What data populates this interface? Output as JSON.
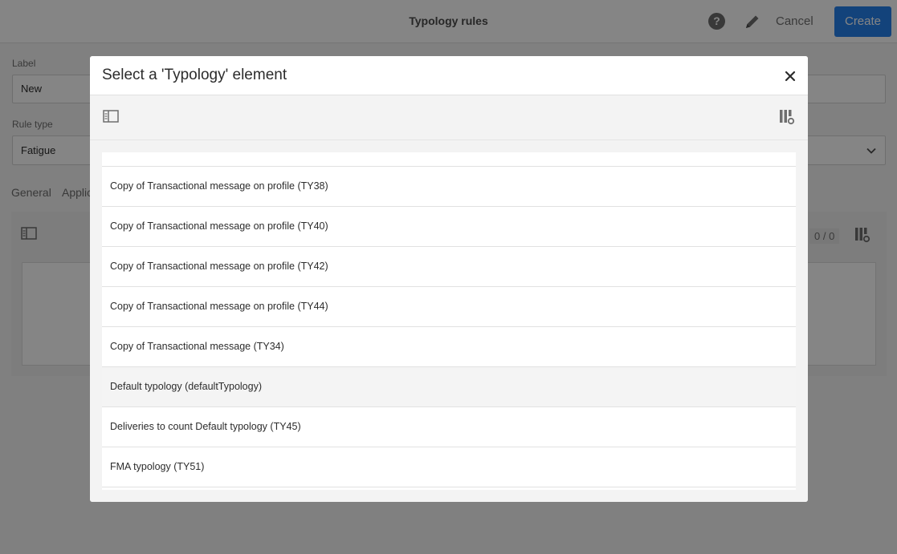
{
  "header": {
    "title": "Typology rules",
    "help_glyph": "?",
    "cancel_label": "Cancel",
    "create_label": "Create",
    "brand_color": "#2680eb"
  },
  "form": {
    "label_field": {
      "label": "Label",
      "value": "New"
    },
    "rule_type_field": {
      "label": "Rule type",
      "value": "Fatigue"
    }
  },
  "tabs": [
    {
      "label": "General"
    },
    {
      "label": "Applic"
    }
  ],
  "panel": {
    "counter": "0 / 0"
  },
  "modal": {
    "title": "Select a 'Typology' element",
    "items": [
      {
        "label": "Copy of Transactional message on profile (TY38)"
      },
      {
        "label": "Copy of Transactional message on profile (TY40)"
      },
      {
        "label": "Copy of Transactional message on profile (TY42)"
      },
      {
        "label": "Copy of Transactional message on profile (TY44)"
      },
      {
        "label": "Copy of Transactional message (TY34)"
      },
      {
        "label": "Default typology (defaultTypology)"
      },
      {
        "label": "Deliveries to count Default typology (TY45)"
      },
      {
        "label": "FMA typology (TY51)"
      }
    ],
    "hovered_item": "Default typology (defaultTypology)"
  },
  "icons": {
    "help": "help-icon",
    "edit": "pencil-icon",
    "close": "close-icon",
    "sidebar_toggle": "sidebar-toggle-icon",
    "column_config": "column-settings-icon",
    "dropdown": "chevron-down-icon"
  }
}
